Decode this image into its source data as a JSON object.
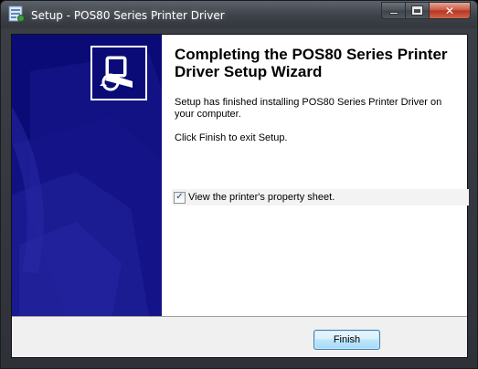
{
  "window": {
    "title": "Setup - POS80 Series Printer Driver",
    "app_icon": "setup-icon",
    "caption_buttons": [
      "minimize",
      "maximize",
      "close"
    ],
    "close_glyph": "✕"
  },
  "wizard": {
    "heading": "Completing the POS80 Series Printer Driver Setup Wizard",
    "body_line1": "Setup has finished installing POS80 Series Printer Driver on your computer.",
    "body_line2": "Click Finish to exit Setup.",
    "checkbox": {
      "label": "View the printer's property sheet.",
      "checked": true,
      "glyph": "✓"
    },
    "banner_icon": "printer-setup-icon",
    "banner_color": "#0b0b78"
  },
  "footer": {
    "finish_label": "Finish"
  },
  "colors": {
    "title_text": "#ffffff",
    "banner": "#0b0b78",
    "button_border": "#3c7fb1"
  }
}
